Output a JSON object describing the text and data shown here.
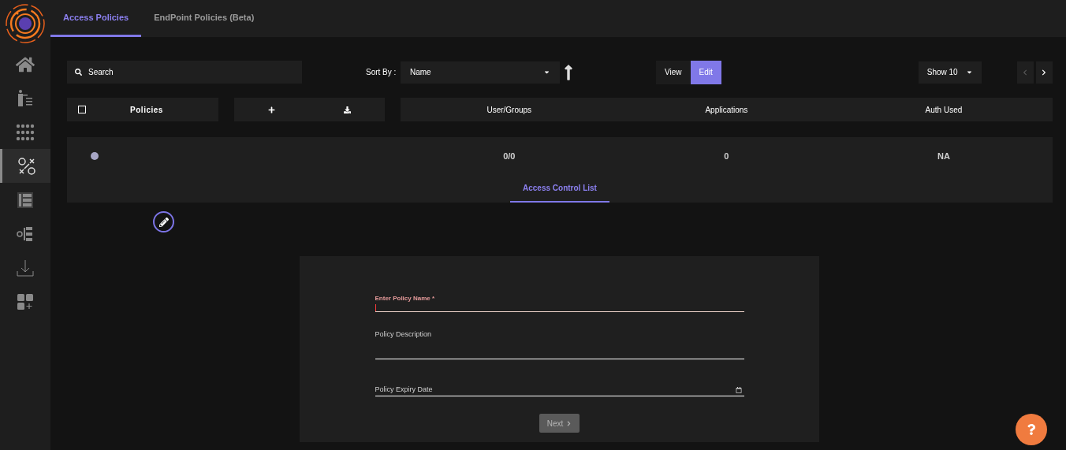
{
  "sidebar": {
    "items": [
      {
        "selected": false
      },
      {
        "selected": false
      },
      {
        "selected": false
      },
      {
        "selected": true
      },
      {
        "selected": false
      },
      {
        "selected": false
      },
      {
        "selected": false
      },
      {
        "selected": false
      }
    ]
  },
  "tabs": [
    {
      "label": "Access Policies",
      "selected": true
    },
    {
      "label": "EndPoint Policies (Beta)",
      "selected": false
    }
  ],
  "search": {
    "placeholder": "Search"
  },
  "sort": {
    "label": "Sort By :",
    "value": "Name"
  },
  "mode": [
    {
      "label": "View",
      "selected": false
    },
    {
      "label": "Edit",
      "selected": true
    }
  ],
  "page_size": "Show 10",
  "pager": {
    "prev_disabled": true,
    "next_disabled": false
  },
  "table": {
    "select_all": {
      "checked": false
    },
    "first_column": "Policies",
    "columns": [
      "User/Groups",
      "Applications",
      "Auth Used"
    ],
    "rows": [
      {
        "color": "#a6a5c4",
        "values": [
          "0/0",
          "0",
          "NA"
        ],
        "subtabs": [
          {
            "label": "Access Control List",
            "selected": true
          }
        ]
      }
    ]
  },
  "form": {
    "fields": [
      {
        "kind": "text",
        "label": "Enter Policy Name *",
        "required": true
      },
      {
        "kind": "textarea",
        "label": "Policy Description",
        "required": false
      },
      {
        "kind": "date",
        "label": "Policy Expiry Date",
        "required": false
      }
    ],
    "next": {
      "label": "Next",
      "disabled": true
    }
  }
}
